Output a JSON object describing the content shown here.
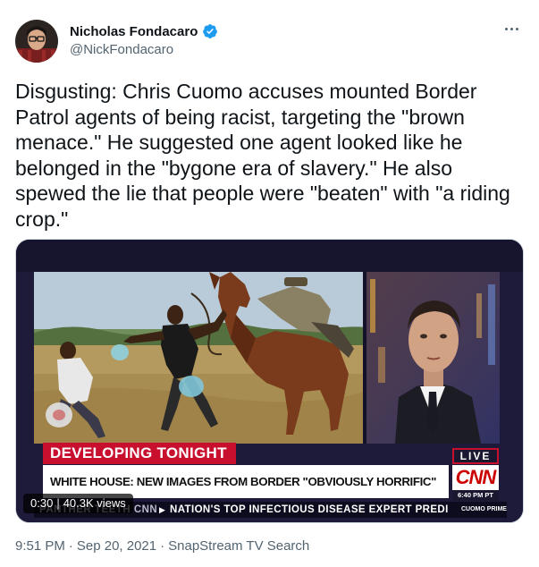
{
  "author": {
    "display_name": "Nicholas Fondacaro",
    "handle": "@NickFondacaro",
    "verified": true,
    "verified_color": "#1d9bf0"
  },
  "more_icon": "more-horizontal-icon",
  "tweet": {
    "text": "Disgusting: Chris Cuomo accuses mounted Border\nPatrol agents of being racist, targeting the \"brown\nmenace.\" He suggested one agent looked like he\nbelonged in the \"bygone era of slavery.\" He also\nspewed the lie that people were \"beaten\" with \"a riding\ncrop.\""
  },
  "video": {
    "duration": "0:30",
    "separator": "|",
    "views": "40.3K views",
    "chyron": {
      "label": "DEVELOPING TONIGHT",
      "headline": "WHITE HOUSE: NEW IMAGES FROM BORDER \"OBVIOUSLY HORRIFIC\"",
      "live": "LIVE",
      "network": "CNN",
      "time": "6:40 PM PT",
      "ticker_left": "PANTHER TEETH CNN",
      "ticker": "NATION'S TOP INFECTIOUS DISEASE EXPERT PREDI",
      "show": "CUOMO PRIME TIME"
    },
    "colors": {
      "cnn_red": "#cc0000",
      "banner_red": "#c8102e"
    }
  },
  "footer": {
    "time": "9:51 PM",
    "dot1": "·",
    "date": "Sep 20, 2021",
    "dot2": "·",
    "source": "SnapStream TV Search"
  }
}
